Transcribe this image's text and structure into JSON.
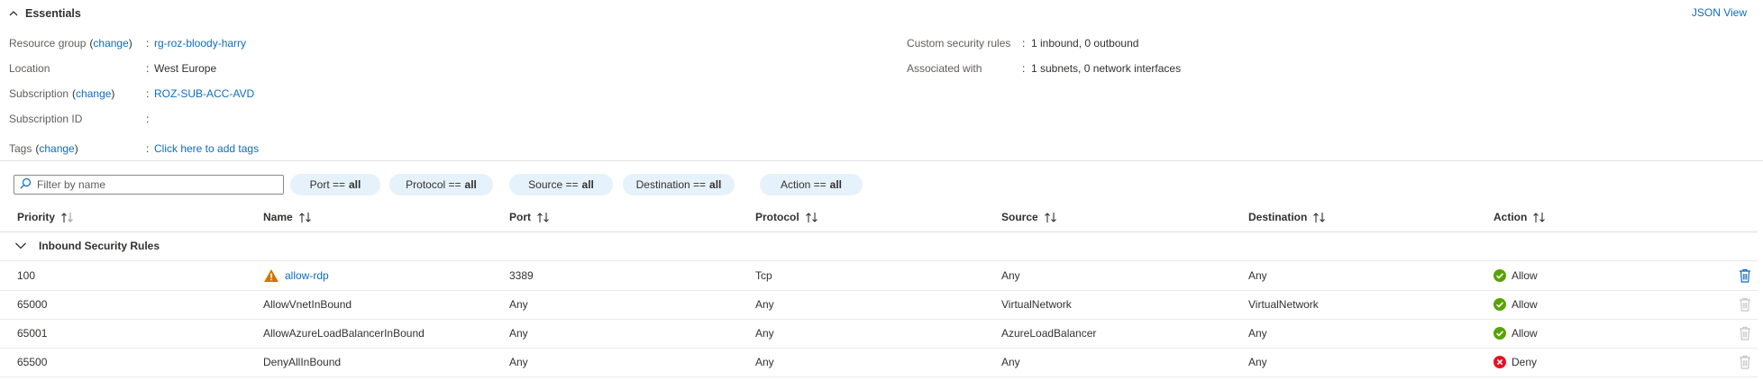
{
  "essentials": {
    "title": "Essentials",
    "json_view": "JSON View",
    "left": [
      {
        "label": "Resource group",
        "change": "change",
        "value": "rg-roz-bloody-harry",
        "value_is_link": true
      },
      {
        "label": "Location",
        "change": "",
        "value": "West Europe",
        "value_is_link": false
      },
      {
        "label": "Subscription",
        "change": "change",
        "value": "ROZ-SUB-ACC-AVD",
        "value_is_link": true
      },
      {
        "label": "Subscription ID",
        "change": "",
        "value": "",
        "value_is_link": false
      },
      {
        "label": "Tags",
        "change": "change",
        "value": "Click here to add tags",
        "value_is_link": true
      }
    ],
    "right": [
      {
        "label": "Custom security rules",
        "value": "1 inbound, 0 outbound"
      },
      {
        "label": "Associated with",
        "value": "1 subnets, 0 network interfaces"
      }
    ],
    "colon": ":",
    "paren_open": "(",
    "paren_close": ")"
  },
  "filter": {
    "placeholder": "Filter by name",
    "pills": [
      {
        "label": "Port ==",
        "value": "all"
      },
      {
        "label": "Protocol ==",
        "value": "all"
      },
      {
        "label": "Source ==",
        "value": "all"
      },
      {
        "label": "Destination ==",
        "value": "all"
      },
      {
        "label": "Action ==",
        "value": "all"
      }
    ]
  },
  "table": {
    "columns": [
      "Priority",
      "Name",
      "Port",
      "Protocol",
      "Source",
      "Destination",
      "Action"
    ],
    "group_label": "Inbound Security Rules",
    "rows": [
      {
        "priority": "100",
        "name": "allow-rdp",
        "warning": true,
        "port": "3389",
        "protocol": "Tcp",
        "source": "Any",
        "destination": "Any",
        "action": "Allow",
        "deletable": true
      },
      {
        "priority": "65000",
        "name": "AllowVnetInBound",
        "warning": false,
        "port": "Any",
        "protocol": "Any",
        "source": "VirtualNetwork",
        "destination": "VirtualNetwork",
        "action": "Allow",
        "deletable": false
      },
      {
        "priority": "65001",
        "name": "AllowAzureLoadBalancerInBound",
        "warning": false,
        "port": "Any",
        "protocol": "Any",
        "source": "AzureLoadBalancer",
        "destination": "Any",
        "action": "Allow",
        "deletable": false
      },
      {
        "priority": "65500",
        "name": "DenyAllInBound",
        "warning": false,
        "port": "Any",
        "protocol": "Any",
        "source": "Any",
        "destination": "Any",
        "action": "Deny",
        "deletable": false
      }
    ]
  },
  "colors": {
    "link": "#0f6cbd",
    "allow": "#57a300",
    "deny": "#e81123",
    "warning": "#d47500",
    "pill_bg": "#e6f2fb",
    "disabled_icon": "#c8c6c4"
  },
  "icons": {
    "collapse": "chevron-up-icon",
    "group": "chevron-down-icon",
    "search": "search-icon",
    "sort": "sort-arrows-icon",
    "warning": "warning-icon",
    "allow": "check-circle-icon",
    "deny": "error-circle-icon",
    "delete": "trash-icon"
  }
}
